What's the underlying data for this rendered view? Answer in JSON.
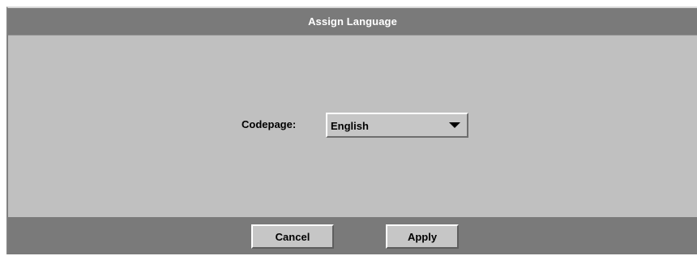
{
  "dialog": {
    "title": "Assign Language"
  },
  "form": {
    "codepage_label": "Codepage:",
    "codepage_value": "English"
  },
  "buttons": {
    "cancel_label": "Cancel",
    "apply_label": "Apply"
  },
  "colors": {
    "title_bar": "#7a7a7a",
    "dialog_body": "#c0c0c0",
    "title_text": "#ffffff"
  },
  "icons": {
    "select_arrow": "triangle-down-icon"
  }
}
